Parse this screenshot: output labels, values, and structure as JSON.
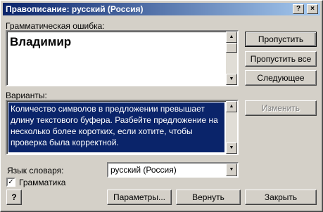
{
  "window": {
    "title": "Правописание: русский (Россия)"
  },
  "titlebar": {
    "help_label": "?",
    "close_label": "×"
  },
  "error_section": {
    "label": "Грамматическая ошибка:",
    "text": "Владимир"
  },
  "suggestions": {
    "label": "Варианты:",
    "text": "Количество символов в предложении превышает длину текстового буфера. Разбейте предложение на несколько более коротких, если хотите, чтобы проверка была корректной."
  },
  "buttons": {
    "skip": "Пропустить",
    "skip_all": "Пропустить все",
    "next": "Следующее",
    "change": "Изменить",
    "options": "Параметры...",
    "undo": "Вернуть",
    "close": "Закрыть"
  },
  "dictionary": {
    "label": "Язык словаря:",
    "value": "русский (Россия)"
  },
  "grammar": {
    "label": "Грамматика",
    "checked": true
  },
  "help_icon_label": "?"
}
